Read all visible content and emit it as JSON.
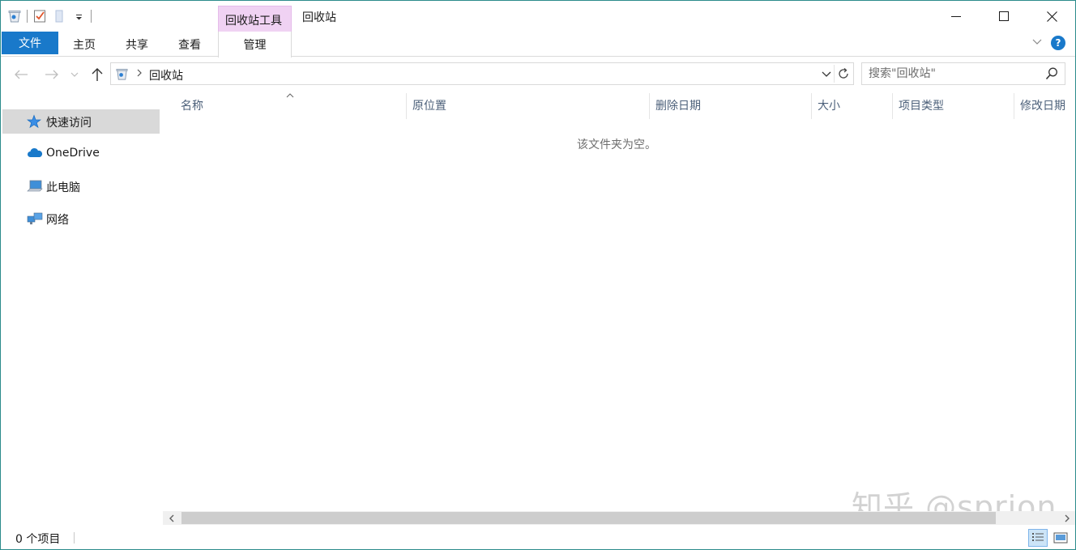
{
  "title_bar": {
    "context_tab_group": "回收站工具",
    "window_title": "回收站",
    "qat_dropdown_icon": "chevron-down-icon",
    "minimize_icon": "minimize-icon",
    "maximize_icon": "maximize-icon",
    "close_icon": "close-icon"
  },
  "ribbon": {
    "tabs": [
      {
        "label": "文件"
      },
      {
        "label": "主页"
      },
      {
        "label": "共享"
      },
      {
        "label": "查看"
      },
      {
        "label": "管理"
      }
    ],
    "accent_color": "#1979ca",
    "context_color": "#f0d2f3"
  },
  "address_bar": {
    "path": [
      "回收站"
    ],
    "search_placeholder": "搜索\"回收站\""
  },
  "nav_pane": {
    "items": [
      {
        "label": "快速访问",
        "icon": "star-icon",
        "selected": true
      },
      {
        "label": "OneDrive",
        "icon": "cloud-icon",
        "selected": false
      },
      {
        "label": "此电脑",
        "icon": "computer-icon",
        "selected": false
      },
      {
        "label": "网络",
        "icon": "network-icon",
        "selected": false
      }
    ]
  },
  "columns": [
    "名称",
    "原位置",
    "删除日期",
    "大小",
    "项目类型",
    "修改日期"
  ],
  "content": {
    "empty_message": "该文件夹为空。",
    "watermark": "知乎 @sprion"
  },
  "status_bar": {
    "item_count": "0 个项目"
  }
}
